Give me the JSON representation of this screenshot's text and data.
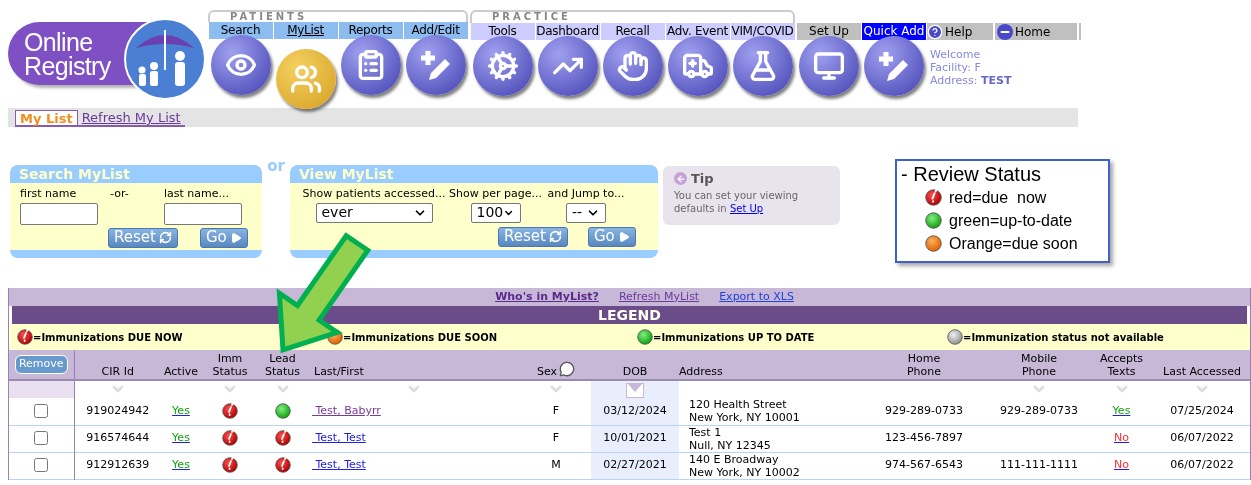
{
  "logo": {
    "lines": [
      "Online",
      "Registry"
    ]
  },
  "nav": {
    "groups": [
      {
        "label": "PATIENTS",
        "kind": "patients",
        "tabs": [
          {
            "label": "Search",
            "selected": false
          },
          {
            "label": "MyList",
            "selected": true
          },
          {
            "label": "Reports",
            "selected": false
          },
          {
            "label": "Add/Edit",
            "selected": false
          }
        ]
      },
      {
        "label": "PRACTICE",
        "kind": "practice",
        "tabs": [
          {
            "label": "Tools",
            "selected": false
          },
          {
            "label": "Dashboard",
            "selected": false
          },
          {
            "label": "Recall",
            "selected": false
          },
          {
            "label": "Adv. Event",
            "selected": false
          },
          {
            "label": "VIM/COVID",
            "selected": false
          }
        ]
      }
    ],
    "extra_tabs": [
      {
        "label": "Set Up",
        "kind": "plain"
      },
      {
        "label": "Quick Add",
        "kind": "highlight"
      }
    ],
    "links": [
      {
        "label": "Help",
        "kind": "help"
      },
      {
        "label": "Home",
        "kind": "home"
      }
    ],
    "user": {
      "welcome": "Welcome",
      "facility": "Facility: F",
      "address_label": "Address:",
      "address": "TEST"
    }
  },
  "sub_tabs": [
    {
      "label": "My List",
      "selected": true
    },
    {
      "label": "Refresh My List",
      "selected": false
    }
  ],
  "search_panel": {
    "title": "Search MyList",
    "fields": [
      {
        "label": "first name"
      },
      {
        "label": "last name..."
      }
    ],
    "separator": "-or-",
    "buttons": [
      {
        "label": "Reset",
        "kind": "reset"
      },
      {
        "label": "Go",
        "kind": "go"
      }
    ]
  },
  "or_text": "or",
  "view_panel": {
    "title": "View MyList",
    "selects": [
      {
        "label": "Show patients accessed...",
        "value": "ever"
      },
      {
        "label": "Show per page...",
        "value": "100"
      },
      {
        "label": "and Jump to...",
        "value": "--"
      }
    ],
    "buttons": [
      {
        "label": "Reset",
        "kind": "reset"
      },
      {
        "label": "Go",
        "kind": "go"
      }
    ]
  },
  "tip": {
    "title": "Tip",
    "text": "You can set your viewing defaults in",
    "link": "Set Up"
  },
  "review_status": {
    "title": "- Review Status",
    "items": [
      {
        "kind": "due_now",
        "label": "red=due  now"
      },
      {
        "kind": "up_to_date",
        "label": "green=up-to-date"
      },
      {
        "kind": "due_soon",
        "label": "Orange=due soon"
      }
    ]
  },
  "table": {
    "links": [
      "Who's in MyList?",
      "Refresh MyList",
      "Export to XLS"
    ],
    "legend_title": "LEGEND",
    "legend": [
      {
        "kind": "due_now",
        "label": "=Immunizations DUE NOW"
      },
      {
        "kind": "due_soon",
        "label": "=Immunizations DUE SOON"
      },
      {
        "kind": "up_to_date",
        "label": "=Immunizations UP TO DATE"
      },
      {
        "kind": "not_available",
        "label": "=Immunization status not available"
      }
    ],
    "remove_button": "Remove",
    "columns": [
      {
        "label": "CIR Id",
        "sortable": true,
        "sorted": false
      },
      {
        "label": "Active",
        "sortable": false,
        "sorted": false
      },
      {
        "label": "Imm\nStatus",
        "sortable": true,
        "sorted": false
      },
      {
        "label": "Lead\nStatus",
        "sortable": true,
        "sorted": false
      },
      {
        "label": "Last/First",
        "sortable": true,
        "sorted": false
      },
      {
        "label": "Sex",
        "sortable": true,
        "sorted": false
      },
      {
        "label": "DOB",
        "sortable": true,
        "sorted": true
      },
      {
        "label": "Address",
        "sortable": false,
        "sorted": false
      },
      {
        "label": "Home\nPhone",
        "sortable": false,
        "sorted": false
      },
      {
        "label": "Mobile\nPhone",
        "sortable": true,
        "sorted": false
      },
      {
        "label": "Accepts\nTexts",
        "sortable": true,
        "sorted": false
      },
      {
        "label": "Last Accessed",
        "sortable": true,
        "sorted": false
      }
    ],
    "rows": [
      {
        "checked": false,
        "cir_id": "919024942",
        "active": "Yes",
        "imm_status": {
          "kind": "due_now"
        },
        "lead_status": {
          "kind": "up_to_date"
        },
        "name": " Test, Babyrr",
        "visited": true,
        "sex": "F",
        "dob": "03/12/2024",
        "address": [
          "120 Health Street",
          "New York, NY 10001"
        ],
        "home_phone": "929-289-0733",
        "mobile_phone": "929-289-0733",
        "accepts_texts": "Yes",
        "accepts": true,
        "last_accessed": "07/25/2024"
      },
      {
        "checked": false,
        "cir_id": "916574644",
        "active": "Yes",
        "imm_status": {
          "kind": "due_now"
        },
        "lead_status": {
          "kind": "due_now"
        },
        "name": " Test, Test",
        "visited": false,
        "sex": "F",
        "dob": "10/01/2021",
        "address": [
          "Test 1",
          "Null, NY 12345"
        ],
        "home_phone": "123-456-7897",
        "accepts_texts": "No",
        "accepts": false,
        "last_accessed": "06/07/2022"
      },
      {
        "checked": false,
        "cir_id": "912912639",
        "active": "Yes",
        "imm_status": {
          "kind": "due_now"
        },
        "lead_status": {
          "kind": "due_now"
        },
        "name": " Test, Test",
        "visited": false,
        "sex": "M",
        "dob": "02/27/2021",
        "address": [
          "140 E Broadway",
          "New York, NY 10002"
        ],
        "home_phone": "974-567-6543",
        "mobile_phone": "111-111-1111",
        "accepts_texts": "No",
        "accepts": false,
        "last_accessed": "06/07/2022"
      }
    ]
  }
}
